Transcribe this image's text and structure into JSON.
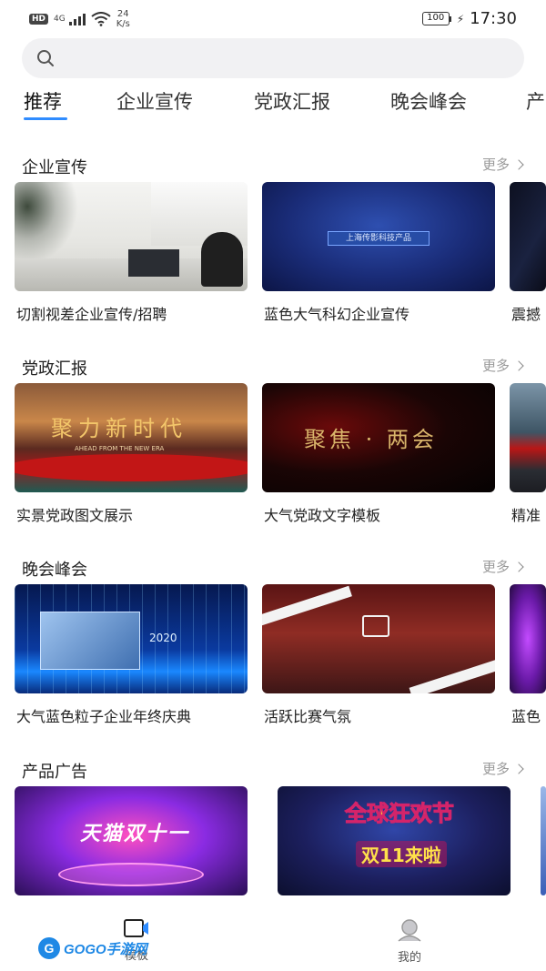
{
  "status_bar": {
    "hd": "HD",
    "network": "4G",
    "speed_value": "24",
    "speed_unit": "K/s",
    "battery": "100",
    "time": "17:30"
  },
  "search": {
    "placeholder": ""
  },
  "tabs": [
    {
      "label": "推荐",
      "active": true
    },
    {
      "label": "企业宣传",
      "active": false
    },
    {
      "label": "党政汇报",
      "active": false
    },
    {
      "label": "晚会峰会",
      "active": false
    },
    {
      "label": "产",
      "active": false
    }
  ],
  "sections": [
    {
      "title": "企业宣传",
      "more": "更多",
      "cards": [
        {
          "title": "切割视差企业宣传/招聘"
        },
        {
          "title": "蓝色大气科幻企业宣传",
          "thumb_text": "上海传影科技产品"
        },
        {
          "title": "震撼"
        }
      ]
    },
    {
      "title": "党政汇报",
      "more": "更多",
      "cards": [
        {
          "title": "实景党政图文展示",
          "thumb_text": "聚力新时代",
          "thumb_sub": "AHEAD FROM THE NEW ERA"
        },
        {
          "title": "大气党政文字模板",
          "thumb_text": "聚焦 · 两会"
        },
        {
          "title": "精准"
        }
      ]
    },
    {
      "title": "晚会峰会",
      "more": "更多",
      "cards": [
        {
          "title": "大气蓝色粒子企业年终庆典",
          "thumb_text": "2020"
        },
        {
          "title": "活跃比赛气氛"
        },
        {
          "title": "蓝色"
        }
      ]
    },
    {
      "title": "产品广告",
      "more": "更多",
      "cards": [
        {
          "title": "",
          "thumb_text": "天猫双十一"
        },
        {
          "title": "",
          "thumb_text": "全球狂欢节",
          "thumb_sub": "双11来啦"
        }
      ]
    }
  ],
  "bottom_nav": {
    "items": [
      {
        "label": "模板",
        "icon": "template-icon",
        "active": true
      },
      {
        "label": "我的",
        "icon": "profile-icon",
        "active": false
      }
    ]
  },
  "watermark": {
    "text": "GOGO手游网"
  },
  "colors": {
    "accent": "#2f8cff",
    "more_text": "#9a9a9a"
  }
}
